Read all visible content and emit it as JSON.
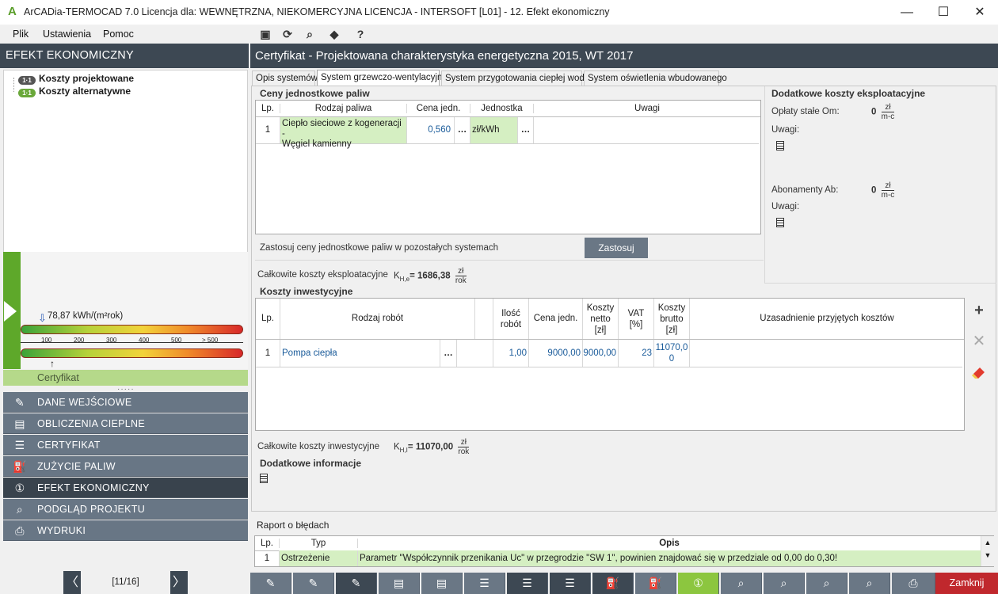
{
  "window": {
    "title": "ArCADia-TERMOCAD 7.0 Licencja dla: WEWNĘTRZNA, NIEKOMERCYJNA LICENCJA - INTERSOFT [L01] - 12. Efekt ekonomiczny",
    "minimize_glyph": "—",
    "maximize_glyph": "☐",
    "close_glyph": "✕"
  },
  "menu": {
    "items": [
      "Plik",
      "Ustawienia",
      "Pomoc"
    ]
  },
  "left": {
    "header": "EFEKT EKONOMICZNY",
    "tree": [
      {
        "label": "Koszty projektowane",
        "badge": "1·1"
      },
      {
        "label": "Koszty alternatywne",
        "badge": "1·1"
      }
    ],
    "energy_value": "78,87 kWh/(m²rok)",
    "scale_ticks": [
      "100",
      "200",
      "300",
      "400",
      "500",
      "> 500"
    ],
    "certificate_label": "Certyfikat",
    "nav": [
      {
        "label": "DANE WEJŚCIOWE",
        "icon": "edit-document-icon"
      },
      {
        "label": "OBLICZENIA CIEPLNE",
        "icon": "calculation-icon"
      },
      {
        "label": "CERTYFIKAT",
        "icon": "certificate-icon"
      },
      {
        "label": "ZUŻYCIE PALIW",
        "icon": "fuel-can-icon"
      },
      {
        "label": "EFEKT EKONOMICZNY",
        "icon": "economic-effect-icon"
      },
      {
        "label": "PODGLĄD PROJEKTU",
        "icon": "preview-icon"
      },
      {
        "label": "WYDRUKI",
        "icon": "printer-icon"
      }
    ],
    "pager": {
      "label": "[11/16]",
      "prev": "〈",
      "next": "〉"
    }
  },
  "right": {
    "header": "Certyfikat - Projektowana charakterystyka energetyczna 2015, WT 2017",
    "tabs": [
      "Opis systemów",
      "System grzewczo-wentylacyjny",
      "System przygotowania ciepłej wody",
      "System oświetlenia wbudowanego"
    ],
    "fuel_prices": {
      "title": "Ceny jednostkowe paliw",
      "columns": [
        "Lp.",
        "Rodzaj paliwa",
        "Cena jedn.",
        "Jednostka",
        "Uwagi"
      ],
      "rows": [
        {
          "lp": "1",
          "fuel_line1": "Ciepło sieciowe z kogeneracji -",
          "fuel_line2": "Węgiel kamienny",
          "price": "0,560",
          "dots": "…",
          "unit": "zł/kWh",
          "unit_dots": "…",
          "notes": ""
        }
      ]
    },
    "apply_text": "Zastosuj ceny jednostkowe paliw w pozostałych systemach",
    "apply_button": "Zastosuj",
    "total_operating": {
      "label": "Całkowite koszty eksploatacyjne",
      "symbol": "K",
      "subscript": "H,e",
      "value": "= 1686,38",
      "unit_num": "zł",
      "unit_den": "rok"
    },
    "additional_costs": {
      "title": "Dodatkowe koszty eksploatacyjne",
      "fixed_label": "Opłaty stałe Om:",
      "fixed_value": "0",
      "fixed_unit_num": "zł",
      "fixed_unit_den": "m-c",
      "notes_label_1": "Uwagi:",
      "subscription_label": "Abonamenty Ab:",
      "subscription_value": "0",
      "subscription_unit_num": "zł",
      "subscription_unit_den": "m-c",
      "notes_label_2": "Uwagi:"
    },
    "investment": {
      "title": "Koszty inwestycyjne",
      "columns": {
        "lp": "Lp.",
        "work": "Rodzaj robót",
        "qty_1": "Ilość",
        "qty_2": "robót",
        "price": "Cena jedn.",
        "net_1": "Koszty",
        "net_2": "netto",
        "net_3": "[zł]",
        "vat_1": "VAT",
        "vat_2": "[%]",
        "gross_1": "Koszty",
        "gross_2": "brutto",
        "gross_3": "[zł]",
        "justification": "Uzasadnienie przyjętych kosztów"
      },
      "rows": [
        {
          "lp": "1",
          "work": "Pompa ciepła",
          "dots": "…",
          "qty": "1,00",
          "price": "9000,00",
          "net": "9000,00",
          "vat": "23",
          "gross_1": "11070,0",
          "gross_2": "0",
          "justification": ""
        }
      ]
    },
    "total_investment": {
      "label": "Całkowite koszty inwestycyjne",
      "symbol": "K",
      "subscript": "H,I",
      "value": "= 11070,00",
      "unit_num": "zł",
      "unit_den": "rok"
    },
    "additional_info": {
      "title": "Dodatkowe informacje"
    },
    "side_tools": {
      "add": "+",
      "remove": "✕"
    }
  },
  "report": {
    "title": "Raport o błędach",
    "columns": [
      "Lp.",
      "Typ",
      "Opis"
    ],
    "rows": [
      {
        "lp": "1",
        "type": "Ostrzeżenie",
        "desc": "Parametr \"Współczynnik przenikania Uc\" w przegrodzie \"SW 1\", powinien znajdować się w przedziale od 0,00 do 0,30!"
      }
    ]
  },
  "bottom_toolbar": {
    "close_label": "Zamknij"
  },
  "colors": {
    "panel_dark": "#3d4853",
    "nav": "#687685",
    "accent_green": "#8cc63f",
    "close_red": "#c0282d"
  }
}
